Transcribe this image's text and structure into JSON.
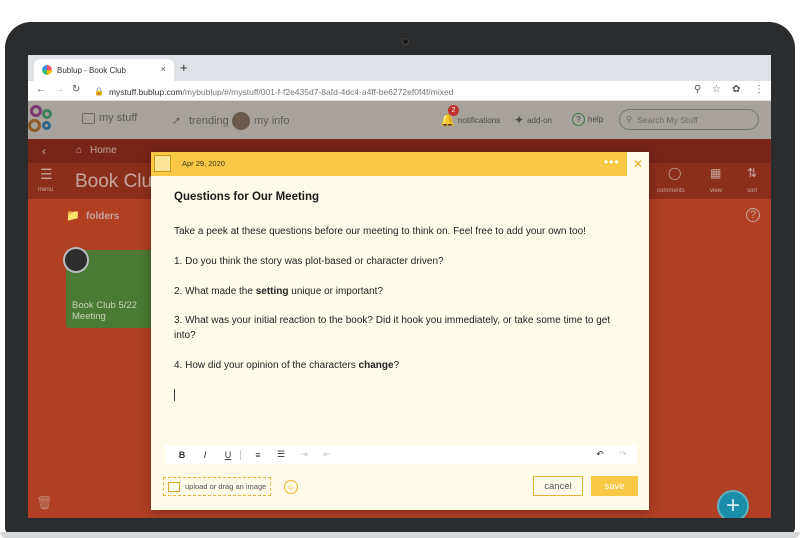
{
  "browser": {
    "tab_title": "Bublup - Book Club",
    "tab_close": "×",
    "new_tab": "+",
    "url_host": "mystuff.bublup.com",
    "url_path": "/mybublup/#/mystuff/001-f-f2e435d7-8afd-4dc4-a4ff-be6272ef0f4f/mixed"
  },
  "header": {
    "my_stuff": "my stuff",
    "trending": "trending",
    "my_info": "my info",
    "notifications": "notifications",
    "notifications_count": "2",
    "addon": "add-on",
    "help": "help",
    "search_placeholder": "Search My Stuff"
  },
  "background": {
    "home_label": "Home",
    "menu_label": "menu",
    "page_title": "Book Club",
    "comments_label": "comments",
    "view_label": "view",
    "sort_label": "sort",
    "folders_label": "folders",
    "folder_card_title": "Book Club 5/22 Meeting",
    "fab_label": "+"
  },
  "modal": {
    "date": "Apr 29, 2020",
    "title": "Questions for Our Meeting",
    "intro": "Take a peek at these questions before our meeting to think on. Feel free to add your own too!",
    "q1": "1. Do you think the story was plot-based or character driven?",
    "q2_before": "2. What made the ",
    "q2_bold": "setting",
    "q2_after": " unique or important?",
    "q3": "3. What was your initial reaction to the book? Did it hook you immediately, or take some time to get into?",
    "q4_before": "4. How did your opinion of the characters ",
    "q4_bold": "change",
    "q4_after": "?",
    "format_bold": "B",
    "format_italic": "I",
    "format_underline": "U",
    "upload_label": "upload or drag an image",
    "cancel_label": "cancel",
    "save_label": "save"
  },
  "colors": {
    "accent_yellow": "#f9c844",
    "app_red": "#b03f24",
    "header_gray": "#a7a29b",
    "fab_teal": "#1a8ea8"
  }
}
